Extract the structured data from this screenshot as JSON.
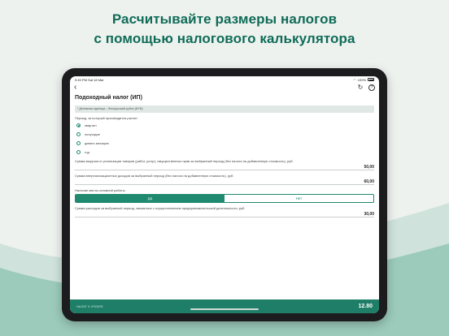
{
  "headline": {
    "line1": "Расчитывайте размеры налогов",
    "line2": "с помощью налогового калькулятора"
  },
  "colors": {
    "accent": "#1f8a6f",
    "footer": "#1f7e67",
    "headline": "#0f6b57"
  },
  "status_bar": {
    "time": "9:49 PM",
    "date": "Sat 18 Mar",
    "battery": "100%"
  },
  "icons": {
    "back": "chevron-left-icon",
    "refresh": "refresh-icon",
    "help": "help-icon"
  },
  "screen_title": "Подоходный налог (ИП)",
  "unit_note": "* Денежная единица – белорусский рубль (BYN)",
  "period": {
    "label": "Период, за который производится расчет:",
    "options": [
      "квартал",
      "полугодие",
      "девять месяцев",
      "год"
    ],
    "selected": "квартал"
  },
  "revenue": {
    "label": "Сумма выручки от реализации товаров (работ, услуг), имущественных прав за выбранный период (без налога на добавленную стоимость), руб.",
    "value": "50,00"
  },
  "non_operating_income": {
    "label": "Сумма внереализационных доходов за выбранный период (без налога на добавленную стоимость), руб.",
    "value": "60,00"
  },
  "main_workplace": {
    "label": "Наличие места основной работы",
    "options": [
      "Да",
      "Нет"
    ],
    "selected": "Да"
  },
  "expenses": {
    "label": "Сумма расходов за выбранный период, связанных с осуществлением предпринимательской деятельности, руб.",
    "value": "30,00"
  },
  "footer": {
    "label": "НАЛОГ К УПЛАТЕ",
    "total": "12.80"
  }
}
